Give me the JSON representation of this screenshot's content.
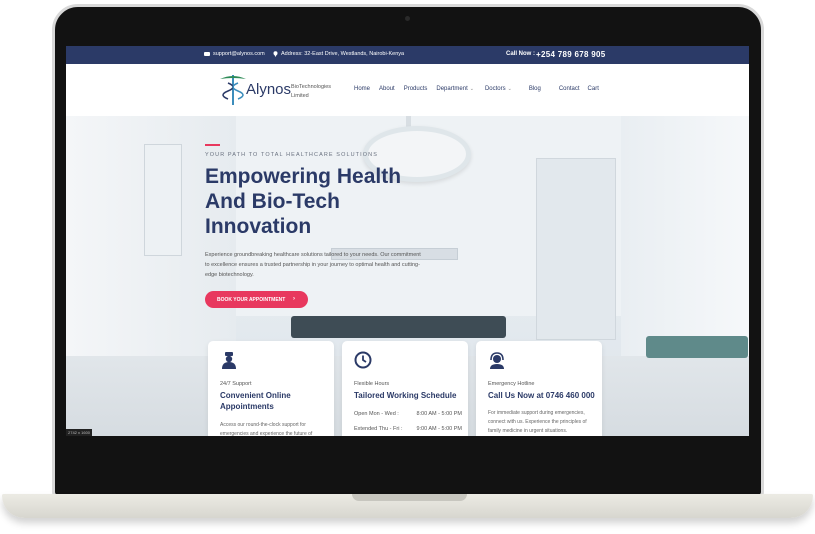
{
  "topbar": {
    "email": "support@alynos.com",
    "address": "Address: 32-East Drive, Westlands, Nairobi-Kenya",
    "call_label": "Call Now :",
    "phone": "+254 789 678 905"
  },
  "brand": {
    "name": "Alynos",
    "tagline_line1": "BioTechnologies",
    "tagline_line2": "Limited",
    "color": "#2b3a67",
    "accent": "#e8385e"
  },
  "nav": {
    "items": [
      "Home",
      "About",
      "Products",
      "Department",
      "Doctors",
      "Blog",
      "Contact",
      "Cart"
    ]
  },
  "hero": {
    "kicker": "YOUR PATH TO TOTAL HEALTHCARE SOLUTIONS",
    "title": "Empowering Health And Bio-Tech Innovation",
    "description": "Experience groundbreaking healthcare solutions tailored to your needs. Our commitment to excellence ensures a trusted partnership in your journey to optimal health and cutting-edge biotechnology.",
    "cta": "BOOK YOUR APPOINTMENT",
    "cta_arrow": "›"
  },
  "cards": [
    {
      "icon": "doctor-icon",
      "label": "24/7 Support",
      "title": "Convenient Online Appointments",
      "body": "Access our round-the-clock support for emergencies and experience the future of"
    },
    {
      "icon": "clock-icon",
      "label": "Flexible Hours",
      "title": "Tailored Working Schedule",
      "schedule": [
        {
          "day": "Open Mon - Wed :",
          "hours": "8:00 AM - 5:00 PM"
        },
        {
          "day": "Extended Thu - Fri :",
          "hours": "9:00 AM - 5:00 PM"
        }
      ]
    },
    {
      "icon": "headset-icon",
      "label": "Emergency Hotline",
      "title": "Call Us Now at 0746 460 000",
      "body": "For immediate support during emergencies, connect with us. Experience the principles of family medicine in urgent situations."
    }
  ],
  "corner_badge": "2742 x 1600"
}
